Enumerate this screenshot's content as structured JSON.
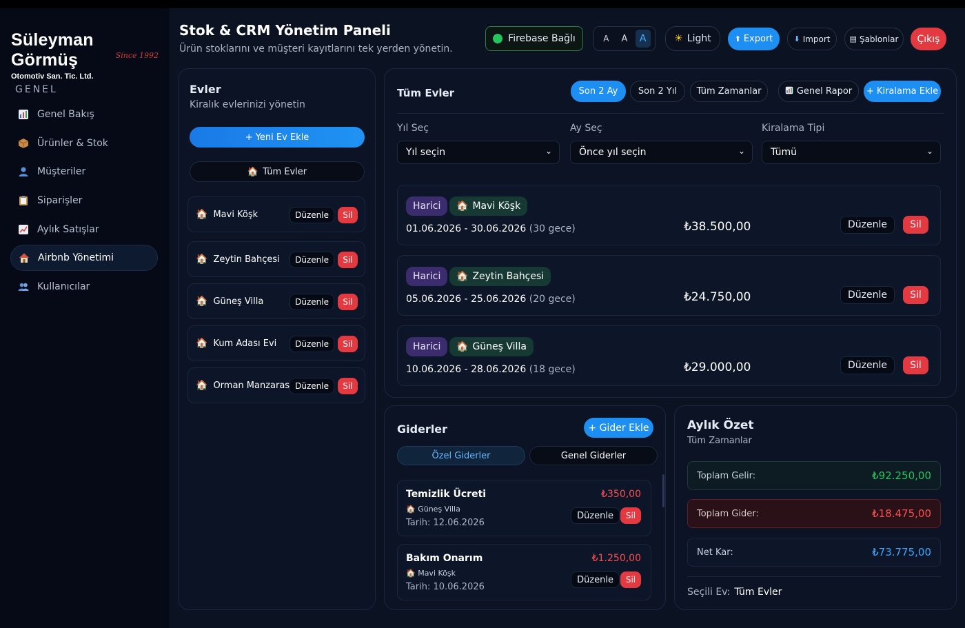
{
  "brand": {
    "name": "Süleyman Görmüş",
    "subtitle": "Otomotiv San. Tic. Ltd.",
    "since": "Since 1992"
  },
  "nav": {
    "section": "GENEL",
    "items": [
      {
        "label": "Genel Bakış",
        "icon": "bar-chart-icon"
      },
      {
        "label": "Ürünler & Stok",
        "icon": "package-icon"
      },
      {
        "label": "Müşteriler",
        "icon": "user-icon"
      },
      {
        "label": "Siparişler",
        "icon": "clipboard-icon"
      },
      {
        "label": "Aylık Satışlar",
        "icon": "trend-icon"
      },
      {
        "label": "Airbnb Yönetimi",
        "icon": "house-icon",
        "active": true
      },
      {
        "label": "Kullanıcılar",
        "icon": "users-icon"
      }
    ]
  },
  "header": {
    "title": "Stok & CRM Yönetim Paneli",
    "subtitle": "Ürün stoklarını ve müşteri kayıtlarını tek yerden yönetin.",
    "firebase": "Firebase Bağlı",
    "font_sizes": [
      "A",
      "A",
      "A"
    ],
    "theme": "Light",
    "export": "Export",
    "import": "Import",
    "templates": "Şablonlar",
    "logout": "Çıkış"
  },
  "houses": {
    "title": "Evler",
    "subtitle": "Kiralık evlerinizi yönetin",
    "add": "+ Yeni Ev Ekle",
    "all": "Tüm Evler",
    "edit_label": "Düzenle",
    "delete_label": "Sil",
    "items": [
      "Mavi Köşk",
      "Zeytin Bahçesi",
      "Güneş Villa",
      "Kum Adası Evi",
      "Orman Manzarası"
    ]
  },
  "rentals": {
    "title": "Tüm Evler",
    "filters": [
      "Son 2 Ay",
      "Son 2 Yıl",
      "Tüm Zamanlar"
    ],
    "report": "Genel Rapor",
    "add": "+ Kiralama Ekle",
    "year_label": "Yıl Seç",
    "year_value": "Yıl seçin",
    "month_label": "Ay Seç",
    "month_value": "Önce yıl seçin",
    "type_label": "Kiralama Tipi",
    "type_value": "Tümü",
    "edit_label": "Düzenle",
    "delete_label": "Sil",
    "items": [
      {
        "type": "Harici",
        "house": "Mavi Köşk",
        "dates": "01.06.2026 - 30.06.2026",
        "nights": "(30 gece)",
        "price": "₺38.500,00"
      },
      {
        "type": "Harici",
        "house": "Zeytin Bahçesi",
        "dates": "05.06.2026 - 25.06.2026",
        "nights": "(20 gece)",
        "price": "₺24.750,00"
      },
      {
        "type": "Harici",
        "house": "Güneş Villa",
        "dates": "10.06.2026 - 28.06.2026",
        "nights": "(18 gece)",
        "price": "₺29.000,00"
      }
    ]
  },
  "expenses": {
    "title": "Giderler",
    "add": "+ Gider Ekle",
    "tab_special": "Özel Giderler",
    "tab_general": "Genel Giderler",
    "edit_label": "Düzenle",
    "delete_label": "Sil",
    "items": [
      {
        "name": "Temizlik Ücreti",
        "house": "Güneş Villa",
        "date": "Tarih: 12.06.2026",
        "amount": "₺350,00"
      },
      {
        "name": "Bakım Onarım",
        "house": "Mavi Köşk",
        "date": "Tarih: 10.06.2026",
        "amount": "₺1.250,00"
      }
    ]
  },
  "summary": {
    "title": "Aylık Özet",
    "subtitle": "Tüm Zamanlar",
    "income_label": "Toplam Gelir:",
    "income_value": "₺92.250,00",
    "expense_label": "Toplam Gider:",
    "expense_value": "₺18.475,00",
    "net_label": "Net Kar:",
    "net_value": "₺73.775,00",
    "selected_label": "Seçili Ev:",
    "selected_value": "Tüm Evler"
  },
  "colors": {
    "accent": "#1d8ef2",
    "danger": "#e23a40",
    "success": "#22c55e",
    "background": "#0b1222"
  }
}
